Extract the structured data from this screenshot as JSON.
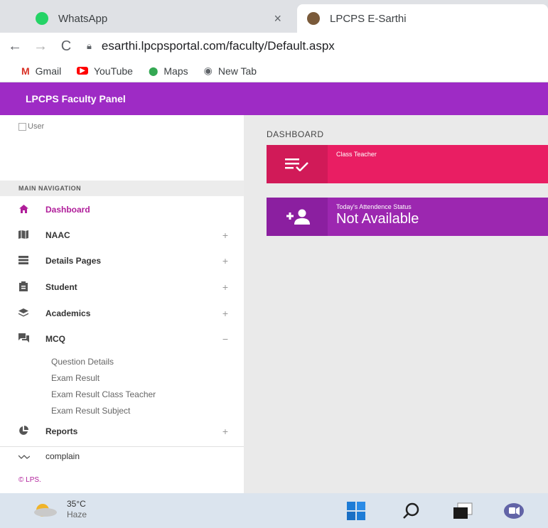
{
  "browser": {
    "tabs": [
      {
        "title": "WhatsApp",
        "close": "×"
      },
      {
        "title": "LPCPS E-Sarthi"
      }
    ],
    "nav": {
      "back": "←",
      "forward": "→",
      "reload": "C"
    },
    "url": "esarthi.lpcpsportal.com/faculty/Default.aspx",
    "bookmarks": [
      {
        "label": "Gmail",
        "icon": "gmail-icon",
        "glyph": "M",
        "color": "#d93025"
      },
      {
        "label": "YouTube",
        "icon": "youtube-icon",
        "glyph": "▶",
        "color": "#ff0000"
      },
      {
        "label": "Maps",
        "icon": "maps-icon",
        "glyph": "⬤",
        "color": "#34a853"
      },
      {
        "label": "New Tab",
        "icon": "newtab-icon",
        "glyph": "◉",
        "color": "#5f6368"
      }
    ]
  },
  "app": {
    "header_title": "LPCPS Faculty Panel",
    "user_img_alt": "User",
    "main_nav_label": "MAIN NAVIGATION",
    "nav": [
      {
        "label": "Dashboard",
        "icon": "home-icon",
        "active": true
      },
      {
        "label": "NAAC",
        "icon": "map-icon",
        "expand": "+"
      },
      {
        "label": "Details Pages",
        "icon": "list-icon",
        "expand": "+"
      },
      {
        "label": "Student",
        "icon": "clipboard-icon",
        "expand": "+"
      },
      {
        "label": "Academics",
        "icon": "layers-icon",
        "expand": "+"
      },
      {
        "label": "MCQ",
        "icon": "chat-icon",
        "expand": "−"
      },
      {
        "label": "Reports",
        "icon": "pie-chart-icon",
        "expand": "+"
      },
      {
        "label": "complain",
        "icon": "wave-icon"
      }
    ],
    "mcq_subitems": [
      "Question Details",
      "Exam Result",
      "Exam Result Class Teacher",
      "Exam Result Subject"
    ],
    "footer_copy": "© LPS."
  },
  "dashboard": {
    "title": "DASHBOARD",
    "cards": [
      {
        "label": "Class Teacher",
        "value": ""
      },
      {
        "label": "Today's Attendence Status",
        "value": "Not Available"
      }
    ]
  },
  "taskbar": {
    "temperature": "35°C",
    "condition": "Haze"
  },
  "colors": {
    "header": "#9e2bc5",
    "card_teacher": "#e91e63",
    "card_attendance": "#9c27b0",
    "active_nav": "#b01e9a"
  }
}
